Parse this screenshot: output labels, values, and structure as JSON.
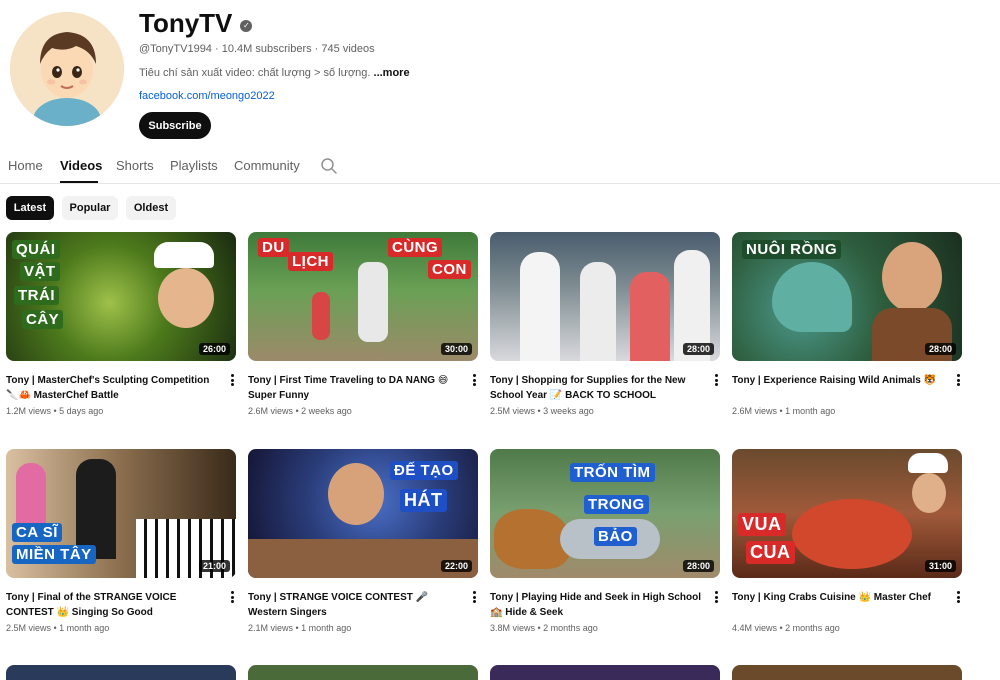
{
  "channel": {
    "name": "TonyTV",
    "verified_icon": "verified-check-icon",
    "handle": "@TonyTV1994",
    "subscribers": "10.4M subscribers",
    "video_count": "745 videos",
    "description": "Tiêu chí sản xuất video: chất lượng > số lượng.",
    "more_label": "...more",
    "link": "facebook.com/meongo2022",
    "subscribe_label": "Subscribe"
  },
  "tabs": [
    {
      "label": "Home"
    },
    {
      "label": "Videos"
    },
    {
      "label": "Shorts"
    },
    {
      "label": "Playlists"
    },
    {
      "label": "Community"
    }
  ],
  "chips": [
    {
      "label": "Latest"
    },
    {
      "label": "Popular"
    },
    {
      "label": "Oldest"
    }
  ],
  "videos": [
    {
      "title": "Tony | MasterChef's Sculpting Competition 🔪🦀 MasterChef Battle",
      "views": "1.2M views",
      "age": "5 days ago",
      "duration": "26:00",
      "overlay": [
        "QUÁI",
        "VẬT",
        "TRÁI",
        "CÂY"
      ]
    },
    {
      "title": "Tony | First Time Traveling to DA NANG 😄 Super Funny",
      "views": "2.6M views",
      "age": "2 weeks ago",
      "duration": "30:00",
      "overlay": [
        "DU",
        "LỊCH",
        "CÙNG",
        "CON"
      ]
    },
    {
      "title": "Tony | Shopping for Supplies for the New School Year 📝 BACK TO SCHOOL",
      "views": "2.5M views",
      "age": "3 weeks ago",
      "duration": "28:00",
      "overlay": []
    },
    {
      "title": "Tony | Experience Raising Wild Animals 🐯",
      "views": "2.6M views",
      "age": "1 month ago",
      "duration": "28:00",
      "overlay": [
        "NUÔI RỒNG"
      ]
    },
    {
      "title": "Tony | Final of the STRANGE VOICE CONTEST 👑 Singing So Good",
      "views": "2.5M views",
      "age": "1 month ago",
      "duration": "21:00",
      "overlay": [
        "CA SĨ",
        "MIỀN TÂY"
      ]
    },
    {
      "title": "Tony | STRANGE VOICE CONTEST 🎤 Western Singers",
      "views": "2.1M views",
      "age": "1 month ago",
      "duration": "22:00",
      "overlay": [
        "ĐẾ TẠO",
        "HÁT"
      ]
    },
    {
      "title": "Tony | Playing Hide and Seek in High School 🏫 Hide & Seek",
      "views": "3.8M views",
      "age": "2 months ago",
      "duration": "28:00",
      "overlay": [
        "TRỐN TÌM",
        "TRONG",
        "BẢO"
      ]
    },
    {
      "title": "Tony | King Crabs Cuisine 👑 Master Chef",
      "views": "4.4M views",
      "age": "2 months ago",
      "duration": "31:00",
      "overlay": [
        "VUA",
        "CUA"
      ]
    }
  ],
  "colors": {
    "accent_dark": "#0f0f0f",
    "link": "#065fd4",
    "secondary_text": "#606060"
  }
}
